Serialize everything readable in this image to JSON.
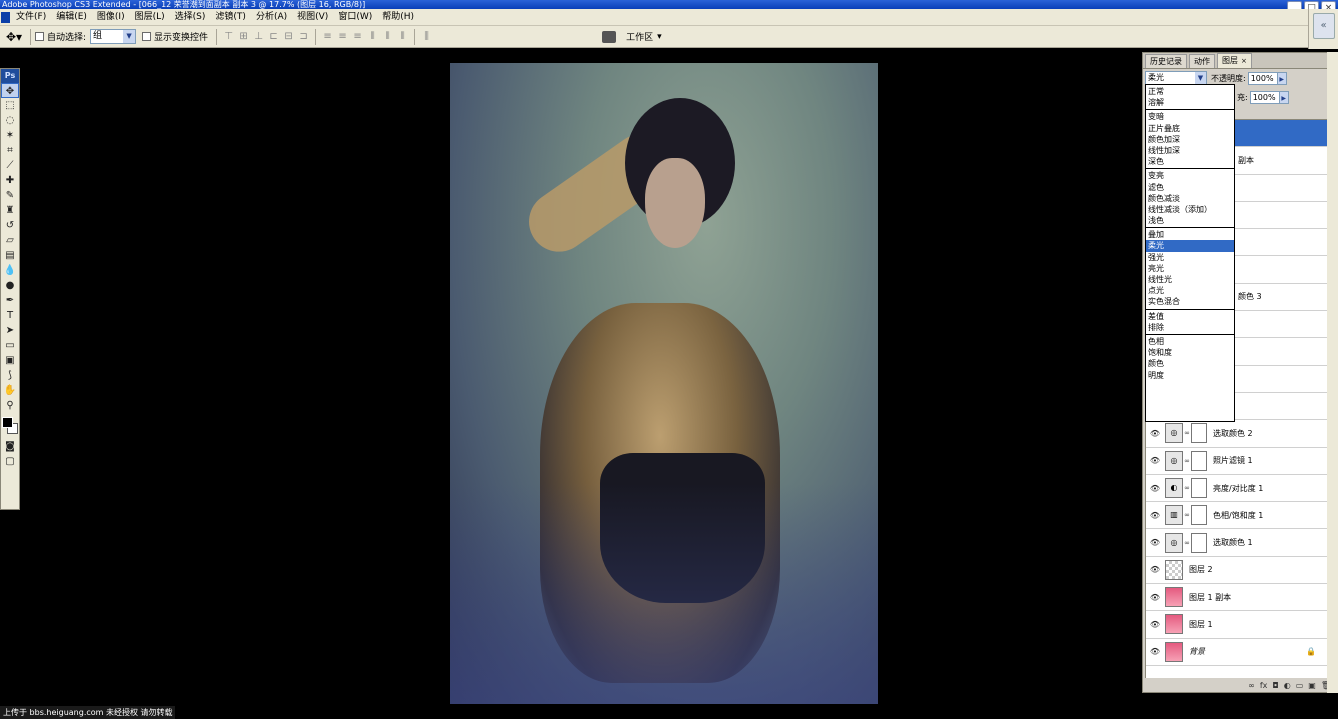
{
  "window": {
    "title": "Adobe Photoshop CS3 Extended - [066_12 荣誉潮到面副本 副本 3 @ 17.7% (图层 16, RGB/8)]",
    "buttons": [
      "_",
      "□",
      "×"
    ]
  },
  "menu": [
    "文件(F)",
    "编辑(E)",
    "图像(I)",
    "图层(L)",
    "选择(S)",
    "滤镜(T)",
    "分析(A)",
    "视图(V)",
    "窗口(W)",
    "帮助(H)"
  ],
  "options": {
    "auto_select_label": "自动选择:",
    "auto_select_value": "组",
    "show_transform_label": "显示变换控件",
    "workspace_label": "工作区"
  },
  "panel": {
    "tabs": [
      "历史记录",
      "动作",
      "图层"
    ],
    "active_tab": "图层",
    "blend_mode": "柔光",
    "opacity_label": "不透明度:",
    "opacity_value": "100%",
    "fill_label": "充:",
    "fill_value": "100%"
  },
  "blend_dropdown": {
    "groups": [
      [
        "正常",
        "溶解"
      ],
      [
        "变暗",
        "正片叠底",
        "颜色加深",
        "线性加深",
        "深色"
      ],
      [
        "变亮",
        "滤色",
        "颜色减淡",
        "线性减淡（添加）",
        "浅色"
      ],
      [
        "叠加",
        "柔光",
        "强光",
        "亮光",
        "线性光",
        "点光",
        "实色混合"
      ],
      [
        "差值",
        "排除"
      ],
      [
        "色相",
        "饱和度",
        "颜色",
        "明度"
      ]
    ],
    "selected": "柔光"
  },
  "layers_partial": {
    "row2_suffix": "副本",
    "row7_suffix": "颜色 3"
  },
  "layers": [
    {
      "name": "选取颜色 2",
      "thumb": "adj"
    },
    {
      "name": "照片滤镜 1",
      "thumb": "adj"
    },
    {
      "name": "亮度/对比度 1",
      "thumb": "adj"
    },
    {
      "name": "色相/饱和度 1",
      "thumb": "adj"
    },
    {
      "name": "选取颜色 1",
      "thumb": "adj"
    },
    {
      "name": "图层 2",
      "thumb": "checker"
    },
    {
      "name": "图层 1 副本",
      "thumb": "pink"
    },
    {
      "name": "图层 1",
      "thumb": "pink"
    },
    {
      "name": "背景",
      "thumb": "pink",
      "locked": true
    }
  ],
  "status": "上传于 bbs.heiguang.com 未经授权 请勿转载"
}
